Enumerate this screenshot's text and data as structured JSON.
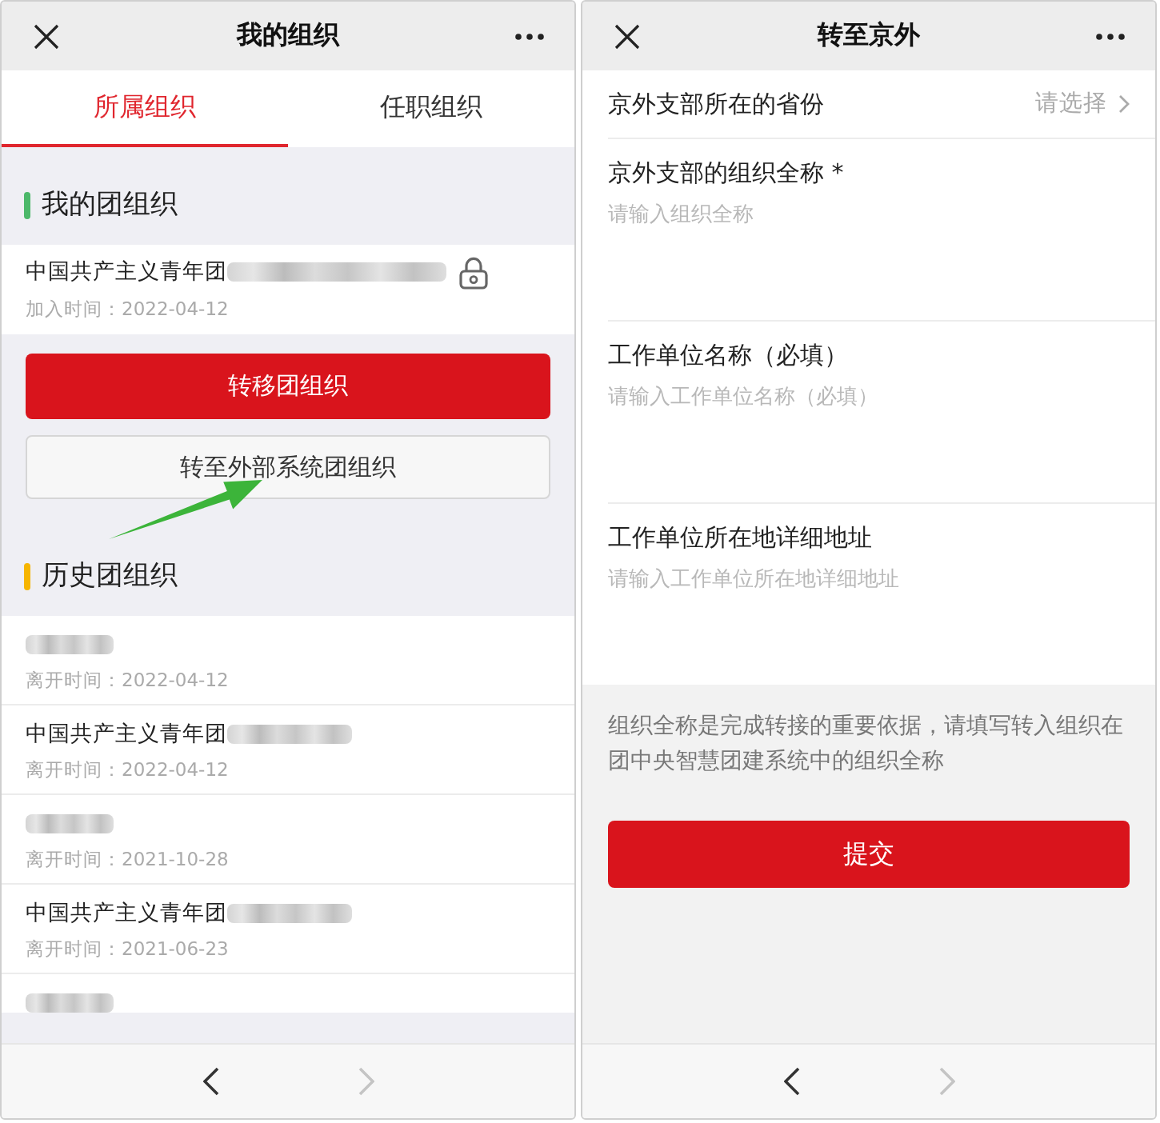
{
  "organizations_page": {
    "header": {
      "title": "我的组织"
    },
    "tabs": [
      {
        "label": "所属组织",
        "selected": true
      },
      {
        "label": "任职组织",
        "selected": false
      }
    ],
    "current_section": {
      "title": "我的团组织",
      "color": "#4cb86a",
      "membership": {
        "name": "中国共产主义青年团",
        "redacted": true,
        "locked": true,
        "date_label": "加入时间：2022-04-12"
      }
    },
    "actions": [
      {
        "kind": "primary",
        "label": "转移团组织"
      },
      {
        "kind": "secondary",
        "label": "转至外部系统团组织"
      }
    ],
    "annotations": [
      {
        "kind": "arrow"
      }
    ],
    "history_section": {
      "title": "历史团组织",
      "color": "#f6b500",
      "items": [
        {
          "redacted": true,
          "date_label": "离开时间：2022-04-12"
        },
        {
          "name": "中国共产主义青年团",
          "redacted": true,
          "date_label": "离开时间：2022-04-12"
        },
        {
          "redacted": true,
          "date_label": "离开时间：2021-10-28"
        },
        {
          "name": "中国共产主义青年团",
          "redacted": true,
          "date_label": "离开时间：2021-06-23"
        },
        {
          "redacted": true
        }
      ]
    },
    "nav_buttons": [
      {
        "kind": "back",
        "disabled": false
      },
      {
        "kind": "forward",
        "disabled": true
      }
    ]
  },
  "transfer_page": {
    "header": {
      "title": "转至京外"
    },
    "province": {
      "label": "京外支部所在的省份",
      "placeholder": "请选择"
    },
    "fields": [
      {
        "label": "京外支部的组织全称 *",
        "placeholder": "请输入组织全称"
      },
      {
        "label": "工作单位名称（必填）",
        "placeholder": "请输入工作单位名称（必填）"
      },
      {
        "label": "工作单位所在地详细地址",
        "placeholder": "请输入工作单位所在地详细地址"
      }
    ],
    "note": "组织全称是完成转接的重要依据，请填写转入组织在团中央智慧团建系统中的组织全称",
    "submit": {
      "label": "提交"
    },
    "nav_buttons": [
      {
        "kind": "back",
        "disabled": false
      },
      {
        "kind": "forward",
        "disabled": true
      }
    ]
  }
}
